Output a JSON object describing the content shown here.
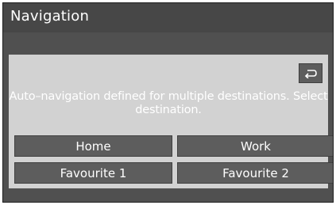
{
  "header": {
    "title": "Navigation"
  },
  "dialog": {
    "back_icon": "return-arrow-icon",
    "message_line1": "Auto–navigation defined for multiple destinations. Select",
    "message_line2": "destination.",
    "buttons": [
      {
        "label": "Home"
      },
      {
        "label": "Work"
      },
      {
        "label": "Favourite 1"
      },
      {
        "label": "Favourite 2"
      }
    ]
  }
}
